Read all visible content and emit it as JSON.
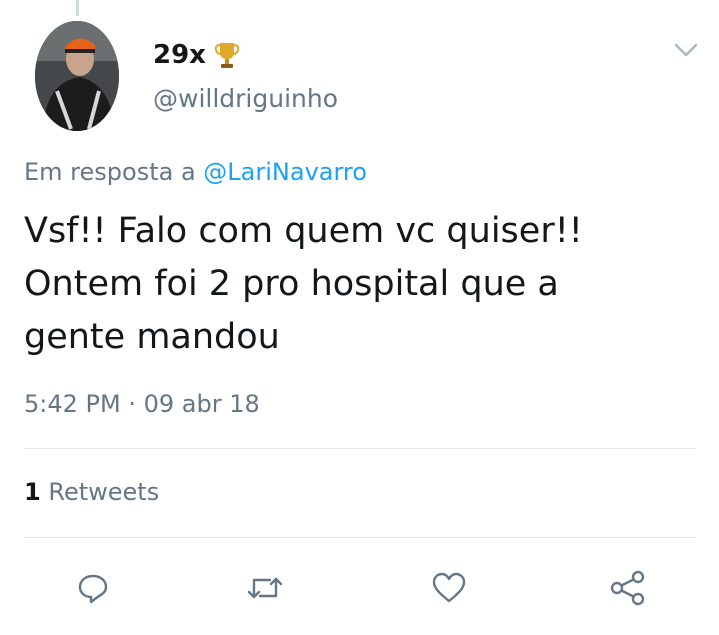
{
  "tweet": {
    "display_name": "29x",
    "display_name_emoji_icon": "trophy-icon",
    "handle": "@willdriguinho",
    "reply_prefix": "Em resposta a",
    "reply_mention": "@LariNavarro",
    "text": "Vsf!! Falo com quem vc quiser!!\nOntem foi 2 pro hospital que a\ngente mandou",
    "time": "5:42 PM",
    "separator": "·",
    "date": "09 abr 18",
    "retweet_count": "1",
    "retweet_label": "Retweets"
  },
  "actions": {
    "reply_icon": "reply-icon",
    "retweet_icon": "retweet-icon",
    "like_icon": "heart-icon",
    "share_icon": "share-icon"
  },
  "colors": {
    "link": "#1da1f2",
    "secondary_text": "#657786",
    "primary_text": "#14171a",
    "divider": "#e1e8ed"
  }
}
